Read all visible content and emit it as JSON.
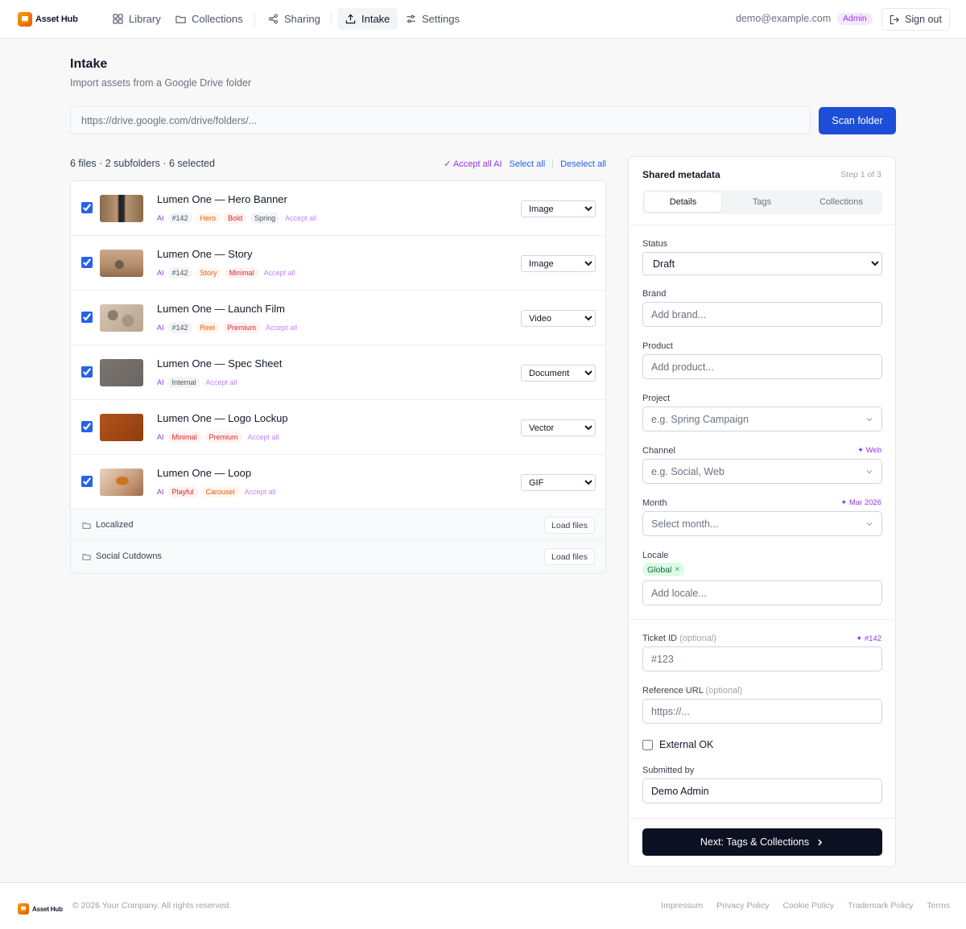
{
  "app": {
    "name": "Asset Hub"
  },
  "nav": {
    "items": [
      {
        "label": "Library"
      },
      {
        "label": "Collections"
      },
      {
        "label": "Sharing"
      },
      {
        "label": "Intake"
      },
      {
        "label": "Settings"
      }
    ],
    "active": "Intake",
    "user_email": "demo@example.com",
    "role_badge": "Admin",
    "signout_label": "Sign out"
  },
  "page": {
    "title": "Intake",
    "subtitle": "Import assets from a Google Drive folder",
    "url_placeholder": "https://drive.google.com/drive/folders/...",
    "scan_label": "Scan folder"
  },
  "summary": {
    "text": "6 files · 2 subfolders · 6 selected",
    "accept_all_ai": "✓ Accept all AI",
    "select_all": "Select all",
    "deselect_all": "Deselect all"
  },
  "files": [
    {
      "name": "Lumen One — Hero Banner",
      "ai_label": "AI",
      "tags": [
        "#142",
        "Hero",
        "Bold",
        "Spring"
      ],
      "accept": "Accept all",
      "type": "Image",
      "checked": true
    },
    {
      "name": "Lumen One — Story",
      "ai_label": "AI",
      "tags": [
        "#142",
        "Story",
        "Minimal"
      ],
      "accept": "Accept all",
      "type": "Image",
      "checked": true
    },
    {
      "name": "Lumen One — Launch Film",
      "ai_label": "AI",
      "tags": [
        "#142",
        "Reel",
        "Premium"
      ],
      "accept": "Accept all",
      "type": "Video",
      "checked": true
    },
    {
      "name": "Lumen One — Spec Sheet",
      "ai_label": "AI",
      "tags": [
        "Internal"
      ],
      "accept": "Accept all",
      "type": "Document",
      "checked": true
    },
    {
      "name": "Lumen One — Logo Lockup",
      "ai_label": "AI",
      "tags": [
        "Minimal",
        "Premium"
      ],
      "accept": "Accept all",
      "type": "Vector",
      "checked": true
    },
    {
      "name": "Lumen One — Loop",
      "ai_label": "AI",
      "tags": [
        "Playful",
        "Carousel"
      ],
      "accept": "Accept all",
      "type": "GIF",
      "checked": true
    }
  ],
  "type_options": [
    "Image",
    "Video",
    "Document",
    "Vector",
    "GIF"
  ],
  "subfolders": [
    {
      "name": "Localized",
      "action": "Load files"
    },
    {
      "name": "Social Cutdowns",
      "action": "Load files"
    }
  ],
  "panel": {
    "title": "Shared metadata",
    "step": "Step 1 of 3",
    "tabs": [
      "Details",
      "Tags",
      "Collections"
    ],
    "active_tab": "Details",
    "status": {
      "label": "Status",
      "value": "Draft"
    },
    "brand": {
      "label": "Brand",
      "placeholder": "Add brand..."
    },
    "product": {
      "label": "Product",
      "placeholder": "Add product..."
    },
    "project": {
      "label": "Project",
      "placeholder": "e.g. Spring Campaign"
    },
    "channel": {
      "label": "Channel",
      "placeholder": "e.g. Social, Web",
      "ai_hint": "✦ Web"
    },
    "month": {
      "label": "Month",
      "placeholder": "Select month...",
      "ai_hint": "✦ Mar 2026"
    },
    "locale": {
      "label": "Locale",
      "chip": "Global",
      "chip_remove": "×",
      "placeholder": "Add locale..."
    },
    "ticket": {
      "label": "Ticket ID",
      "optional": "(optional)",
      "placeholder": "#123",
      "ai_hint": "✦ #142"
    },
    "reference": {
      "label": "Reference URL",
      "optional": "(optional)",
      "placeholder": "https://..."
    },
    "external_ok": "External OK",
    "submitted_by": {
      "label": "Submitted by",
      "value": "Demo Admin"
    },
    "next_label": "Next: Tags & Collections"
  },
  "footer": {
    "copyright": "© 2026 Your Company. All rights reserved.",
    "links": [
      "Impressum",
      "Privacy Policy",
      "Cookie Policy",
      "Trademark Policy",
      "Terms"
    ]
  },
  "colors": {
    "primary": "#1d4ed8",
    "ai_purple": "#9333ea",
    "dark_button": "#0b1120",
    "brand_orange": "#f97316"
  }
}
